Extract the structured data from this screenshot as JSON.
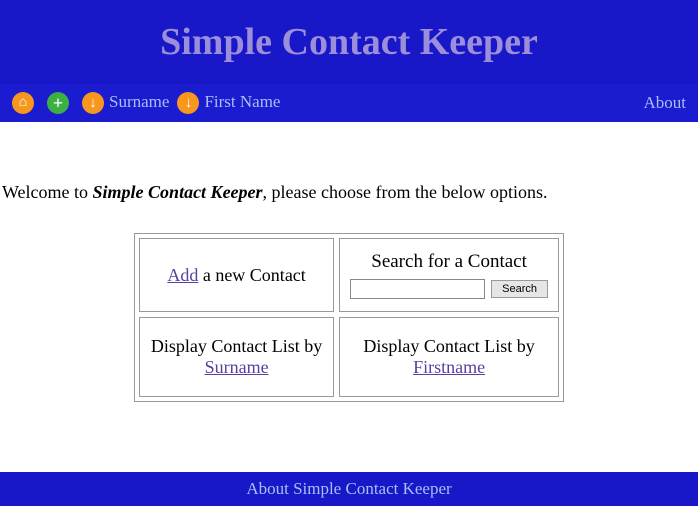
{
  "header": {
    "title": "Simple Contact Keeper"
  },
  "toolbar": {
    "surname": "Surname",
    "firstname": "First Name",
    "about": "About"
  },
  "welcome": {
    "w1": "Welcome ",
    "w2": "to ",
    "app": "Simple Contact Keeper",
    "w3": ", please choose from the below options."
  },
  "grid": {
    "add": {
      "link": "Add",
      "rest": " a new Contact"
    },
    "search": {
      "title": "Search for a Contact",
      "placeholder": "",
      "button": "Search"
    },
    "bysurname": {
      "pre": "Display Contact List by ",
      "link": "Surname"
    },
    "byfirstname": {
      "pre": "Display Contact List by ",
      "link": "Firstname"
    }
  },
  "footer": {
    "about": "About Simple Contact Keeper"
  }
}
